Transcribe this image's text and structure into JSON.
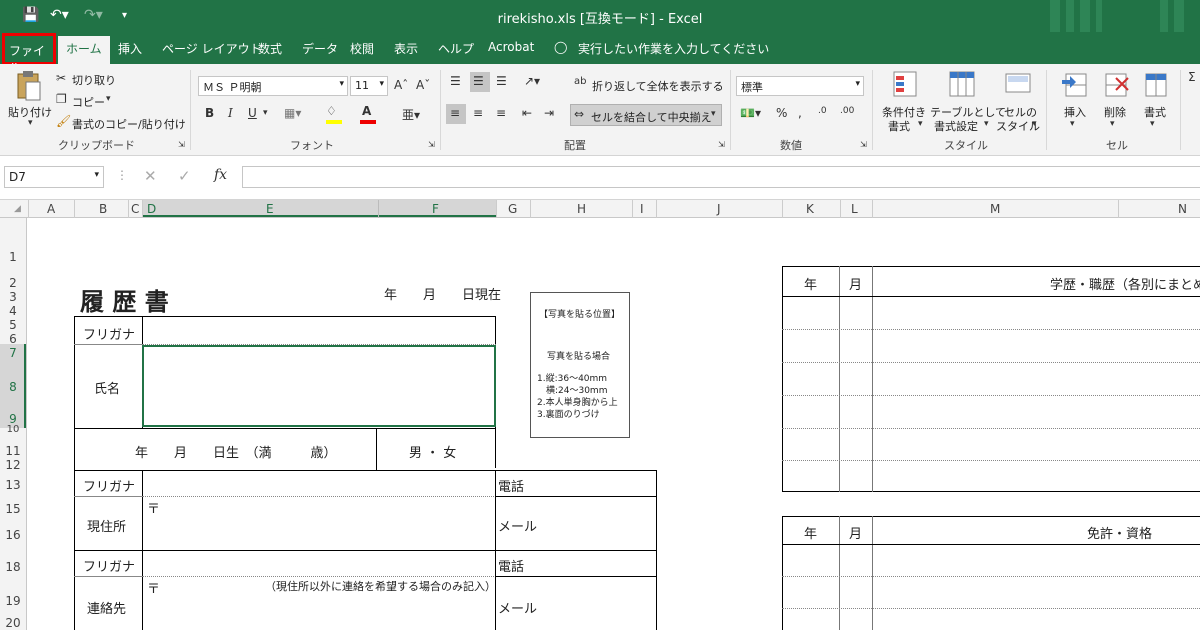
{
  "titlebar": {
    "title": "rirekisho.xls [互換モード] - Excel",
    "accent": "#217346"
  },
  "tabs": {
    "file": "ファイル",
    "home": "ホーム",
    "insert": "挿入",
    "page_layout": "ページ レイアウト",
    "formulas": "数式",
    "data": "データ",
    "review": "校閲",
    "view": "表示",
    "help": "ヘルプ",
    "acrobat": "Acrobat",
    "tell_me": "実行したい作業を入力してください"
  },
  "ribbon": {
    "clipboard": {
      "paste": "貼り付け",
      "cut": "切り取り",
      "copy": "コピー",
      "format_painter": "書式のコピー/貼り付け",
      "group": "クリップボード"
    },
    "font": {
      "name": "ＭＳ Ｐ明朝",
      "size": "11",
      "bold": "B",
      "italic": "I",
      "underline": "U",
      "group": "フォント"
    },
    "alignment": {
      "wrap": "折り返して全体を表示する",
      "merge": "セルを結合して中央揃え",
      "group": "配置"
    },
    "number": {
      "format": "標準",
      "group": "数値"
    },
    "styles": {
      "conditional_1": "条件付き",
      "conditional_2": "書式",
      "table_1": "テーブルとして",
      "table_2": "書式設定",
      "cell_1": "セルの",
      "cell_2": "スタイル",
      "group": "スタイル"
    },
    "cells": {
      "insert": "挿入",
      "delete": "削除",
      "format": "書式",
      "group": "セル"
    }
  },
  "formula_bar": {
    "name_box": "D7",
    "fx": "fx",
    "value": ""
  },
  "columns": [
    "A",
    "B",
    "C",
    "D",
    "E",
    "F",
    "G",
    "H",
    "I",
    "J",
    "K",
    "L",
    "M",
    "N"
  ],
  "rows": [
    "1",
    "2",
    "3",
    "4",
    "5",
    "6",
    "7",
    "8",
    "9",
    "10",
    "11",
    "12",
    "13",
    "15",
    "16",
    "18",
    "19",
    "20"
  ],
  "form": {
    "title": "履 歴 書",
    "date_as_of": "年　　月　　日現在",
    "furigana": "フリガナ",
    "name_label": "氏名",
    "birth_line": "年　　月　　日生　（満　　　歳）",
    "gender": "男 ・ 女",
    "furigana2": "フリガナ",
    "phone": "電話",
    "address_label": "現住所",
    "postal_mark": "〒",
    "email": "メール",
    "furigana3": "フリガナ",
    "phone2": "電話",
    "contact_label": "連絡先",
    "postal_mark2": "〒",
    "contact_note": "（現住所以外に連絡を希望する場合のみ記入）",
    "email2": "メール",
    "photo": {
      "title": "【写真を貼る位置】",
      "subtitle": "写真を貼る場合",
      "line1": "1.縦:36～40mm",
      "line2": "　横:24～30mm",
      "line3": "2.本人単身胸から上",
      "line4": "3.裏面のりづけ"
    },
    "history": {
      "year": "年",
      "month": "月",
      "header": "学歴・職歴（各別にまとめて書"
    },
    "licenses": {
      "year": "年",
      "month": "月",
      "header": "免許・資格"
    }
  }
}
